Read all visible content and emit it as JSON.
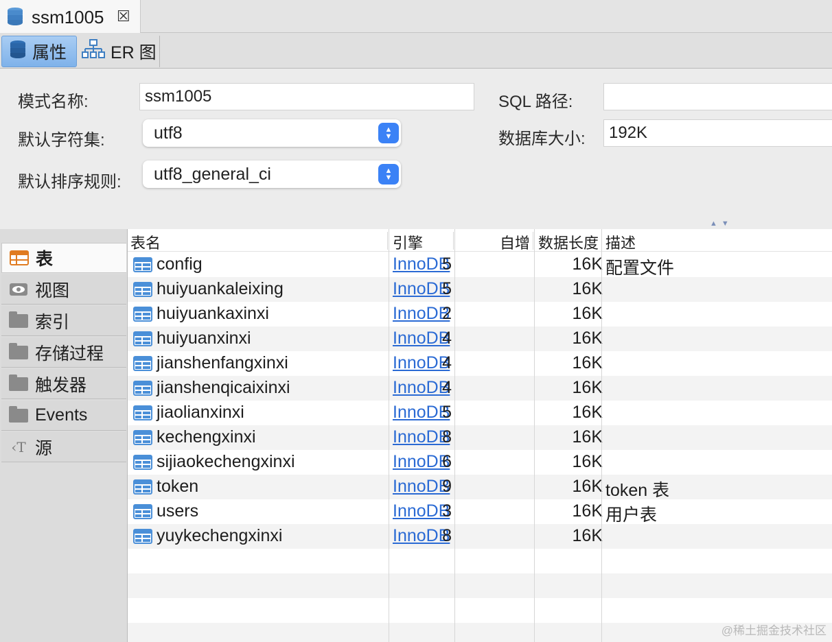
{
  "tab": {
    "title": "ssm1005",
    "close": "☒"
  },
  "subtabs": {
    "properties": "属性",
    "er": "ER 图"
  },
  "form": {
    "schema_name_label": "模式名称:",
    "schema_name_value": "ssm1005",
    "charset_label": "默认字符集:",
    "charset_value": "utf8",
    "collation_label": "默认排序规则:",
    "collation_value": "utf8_general_ci",
    "sql_path_label": "SQL 路径:",
    "sql_path_value": "",
    "db_size_label": "数据库大小:",
    "db_size_value": "192K"
  },
  "nav": {
    "items": [
      {
        "label": "表",
        "icon": "table-icon"
      },
      {
        "label": "视图",
        "icon": "eye-icon"
      },
      {
        "label": "索引",
        "icon": "folder-icon"
      },
      {
        "label": "存储过程",
        "icon": "folder-icon"
      },
      {
        "label": "触发器",
        "icon": "folder-icon"
      },
      {
        "label": "Events",
        "icon": "folder-icon"
      },
      {
        "label": "源",
        "icon": "source-icon"
      }
    ]
  },
  "table": {
    "headers": {
      "name": "表名",
      "engine": "引擎",
      "auto_inc": "自增",
      "data_length": "数据长度",
      "desc": "描述"
    },
    "rows": [
      {
        "name": "config",
        "engine": "InnoDB",
        "auto_inc": "5",
        "data_length": "16K",
        "desc": "配置文件"
      },
      {
        "name": "huiyuankaleixing",
        "engine": "InnoDB",
        "auto_inc": "5",
        "data_length": "16K",
        "desc": ""
      },
      {
        "name": "huiyuankaxinxi",
        "engine": "InnoDB",
        "auto_inc": "2",
        "data_length": "16K",
        "desc": ""
      },
      {
        "name": "huiyuanxinxi",
        "engine": "InnoDB",
        "auto_inc": "4",
        "data_length": "16K",
        "desc": ""
      },
      {
        "name": "jianshenfangxinxi",
        "engine": "InnoDB",
        "auto_inc": "4",
        "data_length": "16K",
        "desc": ""
      },
      {
        "name": "jianshenqicaixinxi",
        "engine": "InnoDB",
        "auto_inc": "4",
        "data_length": "16K",
        "desc": ""
      },
      {
        "name": "jiaolianxinxi",
        "engine": "InnoDB",
        "auto_inc": "5",
        "data_length": "16K",
        "desc": ""
      },
      {
        "name": "kechengxinxi",
        "engine": "InnoDB",
        "auto_inc": "8",
        "data_length": "16K",
        "desc": ""
      },
      {
        "name": "sijiaokechengxinxi",
        "engine": "InnoDB",
        "auto_inc": "6",
        "data_length": "16K",
        "desc": ""
      },
      {
        "name": "token",
        "engine": "InnoDB",
        "auto_inc": "9",
        "data_length": "16K",
        "desc": "token 表"
      },
      {
        "name": "users",
        "engine": "InnoDB",
        "auto_inc": "3",
        "data_length": "16K",
        "desc": "用户表"
      },
      {
        "name": "yuykechengxinxi",
        "engine": "InnoDB",
        "auto_inc": "8",
        "data_length": "16K",
        "desc": ""
      }
    ]
  },
  "watermark": "@稀土掘金技术社区",
  "colors": {
    "accent": "#3b82f6",
    "link": "#2a6ad4",
    "table_icon": "#4a8fd8",
    "nav_active_icon": "#e07b20"
  }
}
